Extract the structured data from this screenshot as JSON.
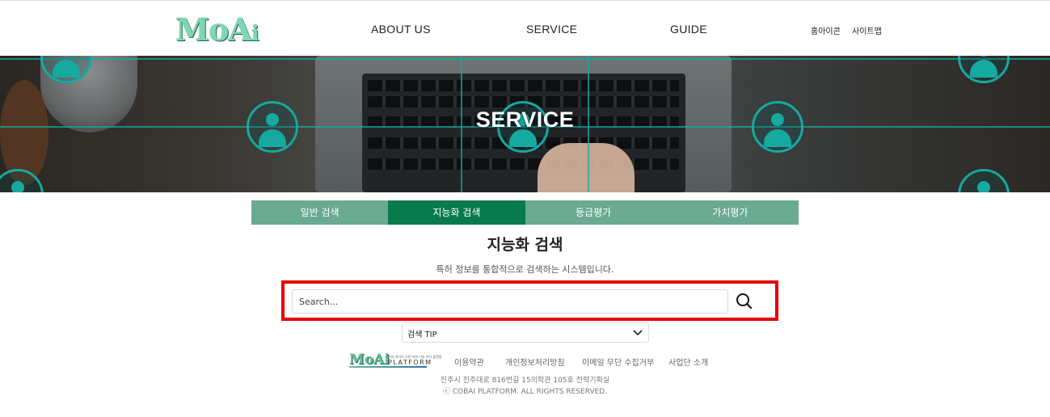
{
  "header": {
    "logo_main": "MoA",
    "logo_suffix": "i",
    "nav": [
      "ABOUT US",
      "SERVICE",
      "GUIDE"
    ],
    "util": [
      "홈아이콘",
      "사이트맵"
    ]
  },
  "banner": {
    "title": "SERVICE"
  },
  "tabs": [
    "일반 검색",
    "지능화 검색",
    "등급평가",
    "가치평가"
  ],
  "active_tab": "지능화 검색",
  "main": {
    "title": "지능화 검색",
    "description": "특허 정보를 통합적으로 검색하는 시스템입니다."
  },
  "search": {
    "placeholder": "Search...",
    "value": "",
    "highlight_color": "#e8000b"
  },
  "tip": {
    "label": "검색 TIP"
  },
  "footer": {
    "logo_main": "MoAi",
    "logo_platform": "PLATFORM",
    "logo_subtext": "특허 데이터 기반 미래 기술 분석 플랫폼",
    "links": [
      "이용약관",
      "개인정보처리방침",
      "이메일 무단 수집거부",
      "사업단 소개"
    ],
    "address": "진주시 진주대로 816번길 15의학관 105호 전략기획실",
    "copyright": "ⓒ COBAI PLATFORM. ALL RIGHTS RESERVED."
  },
  "colors": {
    "tab_bg": "#6aaa92",
    "tab_active_bg": "#087a4c",
    "banner_accent": "#16a9a0"
  },
  "icons": [
    "search-icon",
    "chevron-down-icon",
    "person-icon"
  ]
}
